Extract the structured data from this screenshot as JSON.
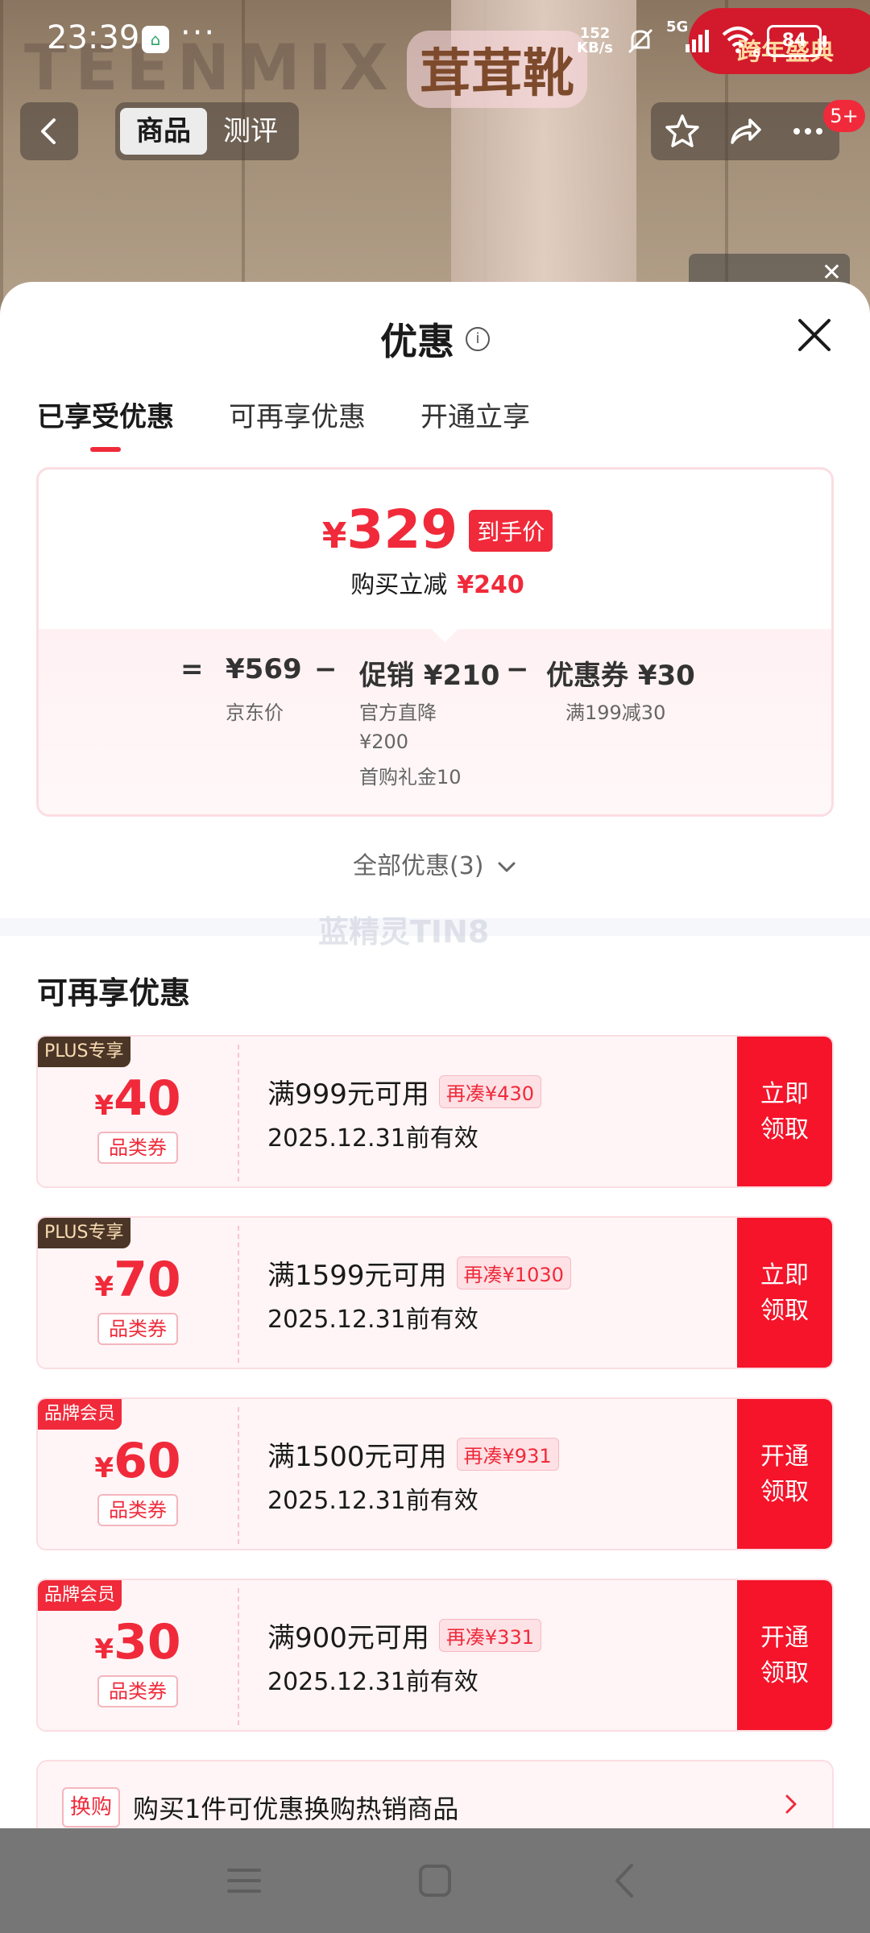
{
  "status_bar": {
    "time": "23:39",
    "more": "···",
    "net_speed_value": "152",
    "net_speed_unit": "KB/s",
    "signal_label": "5G",
    "wifi_label": "6",
    "battery": "84"
  },
  "background": {
    "brand_text": "TEENMIX",
    "brand_cn": "茸茸靴",
    "promo_pill": "跨年盛典"
  },
  "top_nav": {
    "tabs": [
      "商品",
      "测评"
    ],
    "active_tab": 0,
    "badge": "5+"
  },
  "sheet": {
    "title": "优惠",
    "tabs": [
      "已享受优惠",
      "可再享优惠",
      "开通立享"
    ],
    "active_tab": 0
  },
  "price_card": {
    "currency": "¥",
    "final_price": "329",
    "final_tag": "到手价",
    "reduce_label": "购买立减",
    "reduce_amount": "¥240",
    "eq": "=",
    "minus": "−",
    "jd_price": "¥569",
    "jd_label": "京东价",
    "promo_value": "促销 ¥210",
    "promo_detail_1": "官方直降",
    "promo_detail_2": "¥200",
    "promo_detail_3": "首购礼金10",
    "coupon_value": "优惠券 ¥30",
    "coupon_detail": "满199减30"
  },
  "all_offers": "全部优惠(3)",
  "watermark": "蓝精灵TIN8",
  "section_title": "可再享优惠",
  "coupons": [
    {
      "badge": "PLUS专享",
      "badge_type": "plus",
      "amount": "40",
      "category": "品类券",
      "condition": "满999元可用",
      "more": "再凑¥430",
      "expiry": "2025.12.31前有效",
      "action_1": "立即",
      "action_2": "领取"
    },
    {
      "badge": "PLUS专享",
      "badge_type": "plus",
      "amount": "70",
      "category": "品类券",
      "condition": "满1599元可用",
      "more": "再凑¥1030",
      "expiry": "2025.12.31前有效",
      "action_1": "立即",
      "action_2": "领取"
    },
    {
      "badge": "品牌会员",
      "badge_type": "brand",
      "amount": "60",
      "category": "品类券",
      "condition": "满1500元可用",
      "more": "再凑¥931",
      "expiry": "2025.12.31前有效",
      "action_1": "开通",
      "action_2": "领取"
    },
    {
      "badge": "品牌会员",
      "badge_type": "brand",
      "amount": "30",
      "category": "品类券",
      "condition": "满900元可用",
      "more": "再凑¥331",
      "expiry": "2025.12.31前有效",
      "action_1": "开通",
      "action_2": "领取"
    }
  ],
  "exchange": {
    "tag": "换购",
    "text": "购买1件可优惠换购热销商品"
  },
  "colors": {
    "accent_red": "#f02a3a",
    "plus_badge": "#4b3526"
  }
}
